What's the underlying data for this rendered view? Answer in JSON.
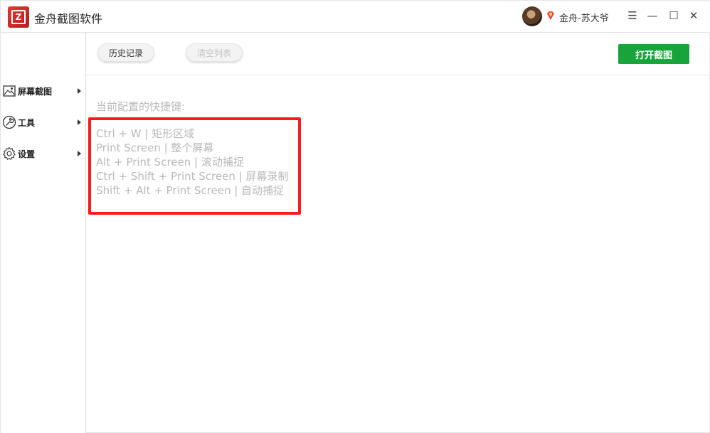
{
  "app": {
    "title": "金舟截图软件",
    "logo_icon": "app-logo-icon"
  },
  "user": {
    "name": "金舟-苏大爷",
    "vip_icon": "vip-diamond-icon",
    "accent": "#e53935"
  },
  "window_controls": {
    "menu": "☰",
    "minimize": "—",
    "maximize": "☐",
    "close": "✕"
  },
  "sidebar": {
    "items": [
      {
        "label": "屏幕截图",
        "icon": "image-icon"
      },
      {
        "label": "工具",
        "icon": "wrench-icon"
      },
      {
        "label": "设置",
        "icon": "gear-icon"
      }
    ]
  },
  "toolbar": {
    "history_label": "历史记录",
    "clear_label": "清空列表",
    "open_label": "打开截图",
    "open_color": "#18a43a"
  },
  "content": {
    "heading": "当前配置的快捷键:",
    "shortcuts": [
      "Ctrl + W  |  矩形区域",
      "Print Screen  |  整个屏幕",
      "Alt + Print Screen  |  滚动捕捉",
      "Ctrl + Shift + Print Screen  |  屏幕录制",
      "Shift + Alt + Print Screen  |  自动捕捉"
    ],
    "highlight_color": "#ff1a1a"
  }
}
